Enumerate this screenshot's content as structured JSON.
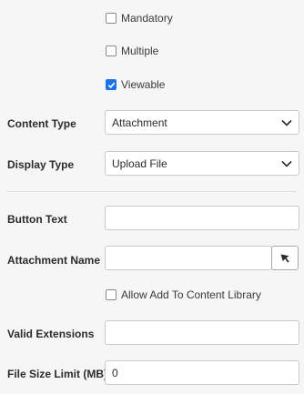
{
  "checkboxes": {
    "mandatory": {
      "label": "Mandatory",
      "checked": false
    },
    "multiple": {
      "label": "Multiple",
      "checked": false
    },
    "viewable": {
      "label": "Viewable",
      "checked": true
    },
    "allow_add": {
      "label": "Allow Add To Content Library",
      "checked": false
    }
  },
  "content_type": {
    "label": "Content Type",
    "value": "Attachment"
  },
  "display_type": {
    "label": "Display Type",
    "value": "Upload File"
  },
  "button_text": {
    "label": "Button Text",
    "value": ""
  },
  "attachment_name": {
    "label": "Attachment Name",
    "value": "",
    "picker_icon": "arrow-pointer-icon"
  },
  "valid_extensions": {
    "label": "Valid Extensions",
    "value": ""
  },
  "file_size_limit": {
    "label": "File Size Limit (MB)",
    "value": "0"
  },
  "colors": {
    "accent": "#1a73e8"
  }
}
